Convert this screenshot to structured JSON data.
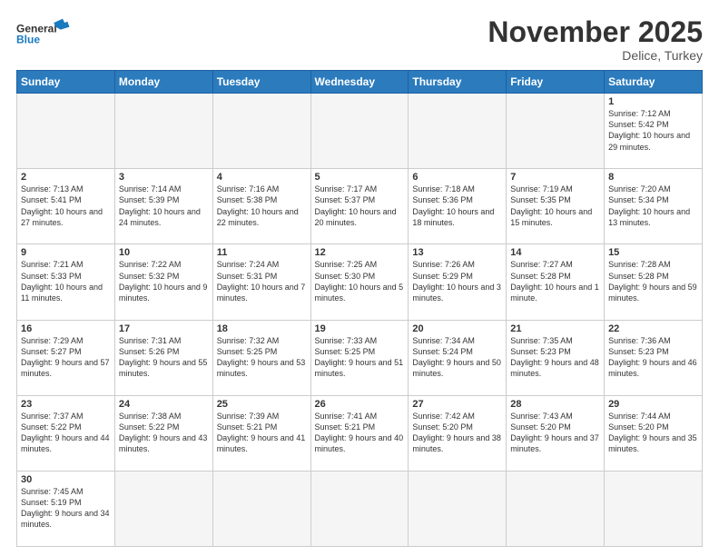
{
  "logo": {
    "general": "General",
    "blue": "Blue"
  },
  "title": "November 2025",
  "subtitle": "Delice, Turkey",
  "days_of_week": [
    "Sunday",
    "Monday",
    "Tuesday",
    "Wednesday",
    "Thursday",
    "Friday",
    "Saturday"
  ],
  "weeks": [
    [
      {
        "day": "",
        "info": "",
        "empty": true
      },
      {
        "day": "",
        "info": "",
        "empty": true
      },
      {
        "day": "",
        "info": "",
        "empty": true
      },
      {
        "day": "",
        "info": "",
        "empty": true
      },
      {
        "day": "",
        "info": "",
        "empty": true
      },
      {
        "day": "",
        "info": "",
        "empty": true
      },
      {
        "day": "1",
        "info": "Sunrise: 7:12 AM\nSunset: 5:42 PM\nDaylight: 10 hours\nand 29 minutes.",
        "empty": false
      }
    ],
    [
      {
        "day": "2",
        "info": "Sunrise: 7:13 AM\nSunset: 5:41 PM\nDaylight: 10 hours\nand 27 minutes.",
        "empty": false
      },
      {
        "day": "3",
        "info": "Sunrise: 7:14 AM\nSunset: 5:39 PM\nDaylight: 10 hours\nand 24 minutes.",
        "empty": false
      },
      {
        "day": "4",
        "info": "Sunrise: 7:16 AM\nSunset: 5:38 PM\nDaylight: 10 hours\nand 22 minutes.",
        "empty": false
      },
      {
        "day": "5",
        "info": "Sunrise: 7:17 AM\nSunset: 5:37 PM\nDaylight: 10 hours\nand 20 minutes.",
        "empty": false
      },
      {
        "day": "6",
        "info": "Sunrise: 7:18 AM\nSunset: 5:36 PM\nDaylight: 10 hours\nand 18 minutes.",
        "empty": false
      },
      {
        "day": "7",
        "info": "Sunrise: 7:19 AM\nSunset: 5:35 PM\nDaylight: 10 hours\nand 15 minutes.",
        "empty": false
      },
      {
        "day": "8",
        "info": "Sunrise: 7:20 AM\nSunset: 5:34 PM\nDaylight: 10 hours\nand 13 minutes.",
        "empty": false
      }
    ],
    [
      {
        "day": "9",
        "info": "Sunrise: 7:21 AM\nSunset: 5:33 PM\nDaylight: 10 hours\nand 11 minutes.",
        "empty": false
      },
      {
        "day": "10",
        "info": "Sunrise: 7:22 AM\nSunset: 5:32 PM\nDaylight: 10 hours\nand 9 minutes.",
        "empty": false
      },
      {
        "day": "11",
        "info": "Sunrise: 7:24 AM\nSunset: 5:31 PM\nDaylight: 10 hours\nand 7 minutes.",
        "empty": false
      },
      {
        "day": "12",
        "info": "Sunrise: 7:25 AM\nSunset: 5:30 PM\nDaylight: 10 hours\nand 5 minutes.",
        "empty": false
      },
      {
        "day": "13",
        "info": "Sunrise: 7:26 AM\nSunset: 5:29 PM\nDaylight: 10 hours\nand 3 minutes.",
        "empty": false
      },
      {
        "day": "14",
        "info": "Sunrise: 7:27 AM\nSunset: 5:28 PM\nDaylight: 10 hours\nand 1 minute.",
        "empty": false
      },
      {
        "day": "15",
        "info": "Sunrise: 7:28 AM\nSunset: 5:28 PM\nDaylight: 9 hours\nand 59 minutes.",
        "empty": false
      }
    ],
    [
      {
        "day": "16",
        "info": "Sunrise: 7:29 AM\nSunset: 5:27 PM\nDaylight: 9 hours\nand 57 minutes.",
        "empty": false
      },
      {
        "day": "17",
        "info": "Sunrise: 7:31 AM\nSunset: 5:26 PM\nDaylight: 9 hours\nand 55 minutes.",
        "empty": false
      },
      {
        "day": "18",
        "info": "Sunrise: 7:32 AM\nSunset: 5:25 PM\nDaylight: 9 hours\nand 53 minutes.",
        "empty": false
      },
      {
        "day": "19",
        "info": "Sunrise: 7:33 AM\nSunset: 5:25 PM\nDaylight: 9 hours\nand 51 minutes.",
        "empty": false
      },
      {
        "day": "20",
        "info": "Sunrise: 7:34 AM\nSunset: 5:24 PM\nDaylight: 9 hours\nand 50 minutes.",
        "empty": false
      },
      {
        "day": "21",
        "info": "Sunrise: 7:35 AM\nSunset: 5:23 PM\nDaylight: 9 hours\nand 48 minutes.",
        "empty": false
      },
      {
        "day": "22",
        "info": "Sunrise: 7:36 AM\nSunset: 5:23 PM\nDaylight: 9 hours\nand 46 minutes.",
        "empty": false
      }
    ],
    [
      {
        "day": "23",
        "info": "Sunrise: 7:37 AM\nSunset: 5:22 PM\nDaylight: 9 hours\nand 44 minutes.",
        "empty": false
      },
      {
        "day": "24",
        "info": "Sunrise: 7:38 AM\nSunset: 5:22 PM\nDaylight: 9 hours\nand 43 minutes.",
        "empty": false
      },
      {
        "day": "25",
        "info": "Sunrise: 7:39 AM\nSunset: 5:21 PM\nDaylight: 9 hours\nand 41 minutes.",
        "empty": false
      },
      {
        "day": "26",
        "info": "Sunrise: 7:41 AM\nSunset: 5:21 PM\nDaylight: 9 hours\nand 40 minutes.",
        "empty": false
      },
      {
        "day": "27",
        "info": "Sunrise: 7:42 AM\nSunset: 5:20 PM\nDaylight: 9 hours\nand 38 minutes.",
        "empty": false
      },
      {
        "day": "28",
        "info": "Sunrise: 7:43 AM\nSunset: 5:20 PM\nDaylight: 9 hours\nand 37 minutes.",
        "empty": false
      },
      {
        "day": "29",
        "info": "Sunrise: 7:44 AM\nSunset: 5:20 PM\nDaylight: 9 hours\nand 35 minutes.",
        "empty": false
      }
    ],
    [
      {
        "day": "30",
        "info": "Sunrise: 7:45 AM\nSunset: 5:19 PM\nDaylight: 9 hours\nand 34 minutes.",
        "empty": false
      },
      {
        "day": "",
        "info": "",
        "empty": true
      },
      {
        "day": "",
        "info": "",
        "empty": true
      },
      {
        "day": "",
        "info": "",
        "empty": true
      },
      {
        "day": "",
        "info": "",
        "empty": true
      },
      {
        "day": "",
        "info": "",
        "empty": true
      },
      {
        "day": "",
        "info": "",
        "empty": true
      }
    ]
  ]
}
